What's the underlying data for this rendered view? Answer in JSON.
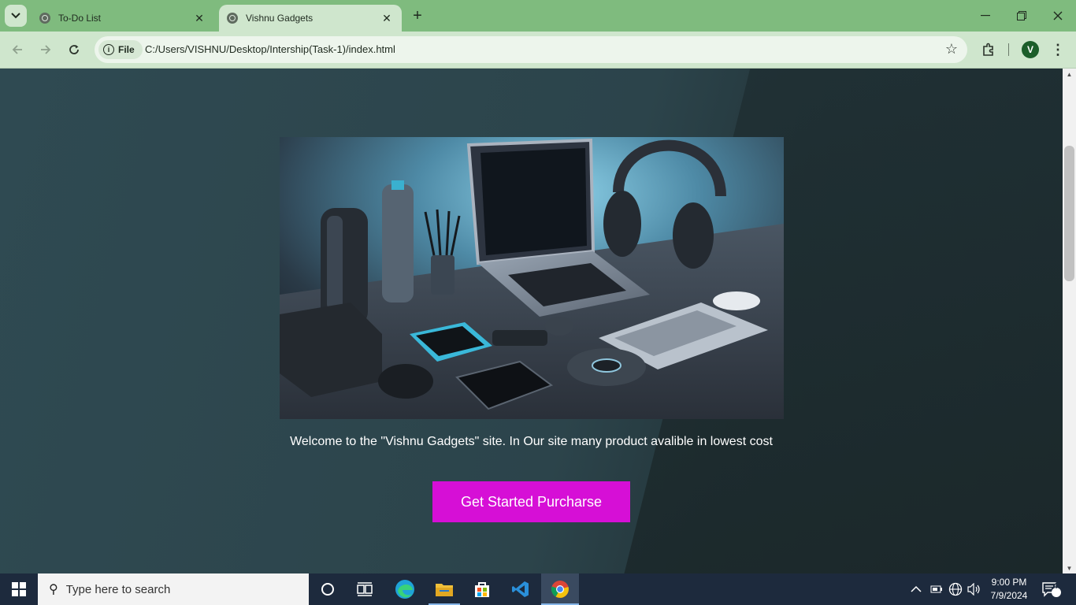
{
  "browser": {
    "tabs": [
      {
        "title": "To-Do List",
        "active": false
      },
      {
        "title": "Vishnu Gadgets",
        "active": true
      }
    ],
    "new_tab_symbol": "+",
    "site_chip_label": "File",
    "url": "C:/Users/VISHNU/Desktop/Intership(Task-1)/index.html",
    "profile_initial": "V"
  },
  "page": {
    "welcome_text": "Welcome to the \"Vishnu Gadgets\" site. In Our site many product avalible in lowest cost",
    "cta_label": "Get Started Purcharse",
    "colors": {
      "cta_background": "#d60fd6",
      "page_background": "#2b3d42",
      "tab_strip": "#7fbb7e",
      "toolbar": "#cfe6cd"
    }
  },
  "taskbar": {
    "search_placeholder": "Type here to search",
    "time": "9:00 PM",
    "date": "7/9/2024",
    "notification_count": "4"
  }
}
